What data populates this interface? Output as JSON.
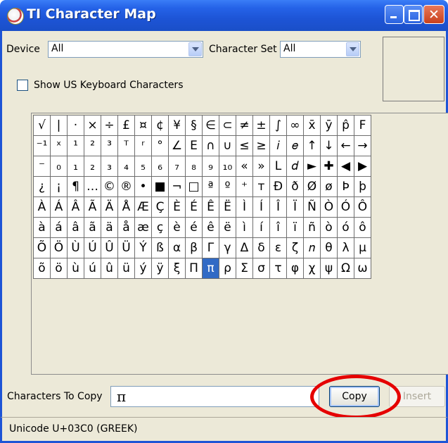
{
  "window": {
    "title": "TI Character Map"
  },
  "device": {
    "label": "Device",
    "value": "All"
  },
  "character_set": {
    "label": "Character Set",
    "value": "All"
  },
  "show_us_keyboard": {
    "label": "Show US Keyboard Characters",
    "checked": false
  },
  "grid": {
    "selected": "π",
    "rows": [
      [
        "√",
        "|",
        "·",
        "×",
        "÷",
        "£",
        "¤",
        "¢",
        "¥",
        "§",
        "∈",
        "⊂",
        "≠",
        "±",
        "∫",
        "∞",
        "x̄",
        "ȳ",
        "p̂",
        "F"
      ],
      [
        "⁻¹",
        "ˣ",
        "¹",
        "²",
        "³",
        "ᵀ",
        "ʳ",
        "°",
        "∠",
        "E",
        "∩",
        "∪",
        "≤",
        "≥",
        "𝑖",
        "𝑒",
        "↑",
        "↓",
        "←",
        "→"
      ],
      [
        "⁻",
        "₀",
        "₁",
        "₂",
        "₃",
        "₄",
        "₅",
        "₆",
        "₇",
        "₈",
        "₉",
        "₁₀",
        "«",
        "»",
        "L",
        "𝑑",
        "►",
        "✚",
        "◀",
        "▶"
      ],
      [
        "¿",
        "¡",
        "¶",
        "…",
        "©",
        "®",
        "•",
        "■",
        "¬",
        "□",
        "ª",
        "º",
        "⁺",
        "ᴛ",
        "Ð",
        "ð",
        "Ø",
        "ø",
        "Þ",
        "þ"
      ],
      [
        "À",
        "Á",
        "Â",
        "Ã",
        "Ä",
        "Å",
        "Æ",
        "Ç",
        "È",
        "É",
        "Ê",
        "Ë",
        "Ì",
        "Í",
        "Î",
        "Ï",
        "Ñ",
        "Ò",
        "Ó",
        "Ô"
      ],
      [
        "à",
        "á",
        "â",
        "ã",
        "ä",
        "å",
        "æ",
        "ç",
        "è",
        "é",
        "ê",
        "ë",
        "ì",
        "í",
        "î",
        "ï",
        "ñ",
        "ò",
        "ó",
        "ô"
      ],
      [
        "Õ",
        "Ö",
        "Ù",
        "Ú",
        "Û",
        "Ü",
        "Ý",
        "ß",
        "α",
        "β",
        "Γ",
        "γ",
        "Δ",
        "δ",
        "ε",
        "ζ",
        "𝑛",
        "θ",
        "λ",
        "μ"
      ],
      [
        "õ",
        "ö",
        "ù",
        "ú",
        "û",
        "ü",
        "ý",
        "ÿ",
        "ξ",
        "Π",
        "π",
        "ρ",
        "Σ",
        "σ",
        "τ",
        "φ",
        "χ",
        "ψ",
        "Ω",
        "ω"
      ]
    ]
  },
  "copy": {
    "label": "Characters To Copy",
    "value": "π",
    "copy_button": "Copy",
    "insert_button": "Insert"
  },
  "status": {
    "text": "Unicode U+03C0 (GREEK)"
  },
  "annotation_color": "#e50000"
}
